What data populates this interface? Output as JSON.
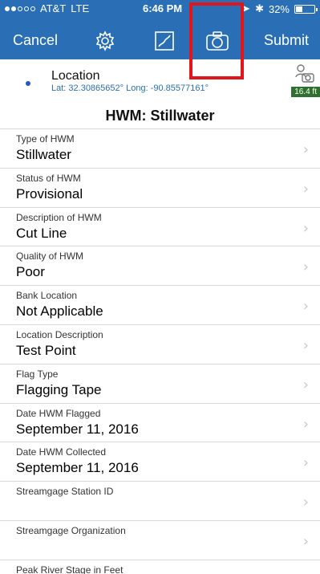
{
  "status_bar": {
    "carrier": "AT&T",
    "network": "LTE",
    "time": "6:46 PM",
    "battery_percent": "32%",
    "signal_filled": 2,
    "signal_total": 5
  },
  "nav": {
    "cancel_label": "Cancel",
    "submit_label": "Submit",
    "icons": [
      "gear-icon",
      "map-icon",
      "camera-icon"
    ]
  },
  "location": {
    "title": "Location",
    "coords": "Lat: 32.30865652° Long: -90.85577161°",
    "badge": "16.4 ft"
  },
  "section_title": "HWM: Stillwater",
  "fields": [
    {
      "label": "Type of HWM",
      "value": "Stillwater"
    },
    {
      "label": "Status of HWM",
      "value": "Provisional"
    },
    {
      "label": "Description of HWM",
      "value": "Cut Line"
    },
    {
      "label": "Quality of HWM",
      "value": "Poor"
    },
    {
      "label": "Bank Location",
      "value": "Not Applicable"
    },
    {
      "label": "Location Description",
      "value": "Test Point"
    },
    {
      "label": "Flag Type",
      "value": "Flagging Tape"
    },
    {
      "label": "Date HWM Flagged",
      "value": "September 11, 2016"
    },
    {
      "label": "Date HWM Collected",
      "value": "September 11, 2016"
    },
    {
      "label": "Streamgage Station ID",
      "value": ""
    },
    {
      "label": "Streamgage Organization",
      "value": ""
    },
    {
      "label": "Peak River Stage in Feet",
      "value": ""
    }
  ],
  "colors": {
    "nav_bg": "#2a6fb6",
    "highlight": "#e0161a",
    "badge_bg": "#2f6f2f"
  }
}
